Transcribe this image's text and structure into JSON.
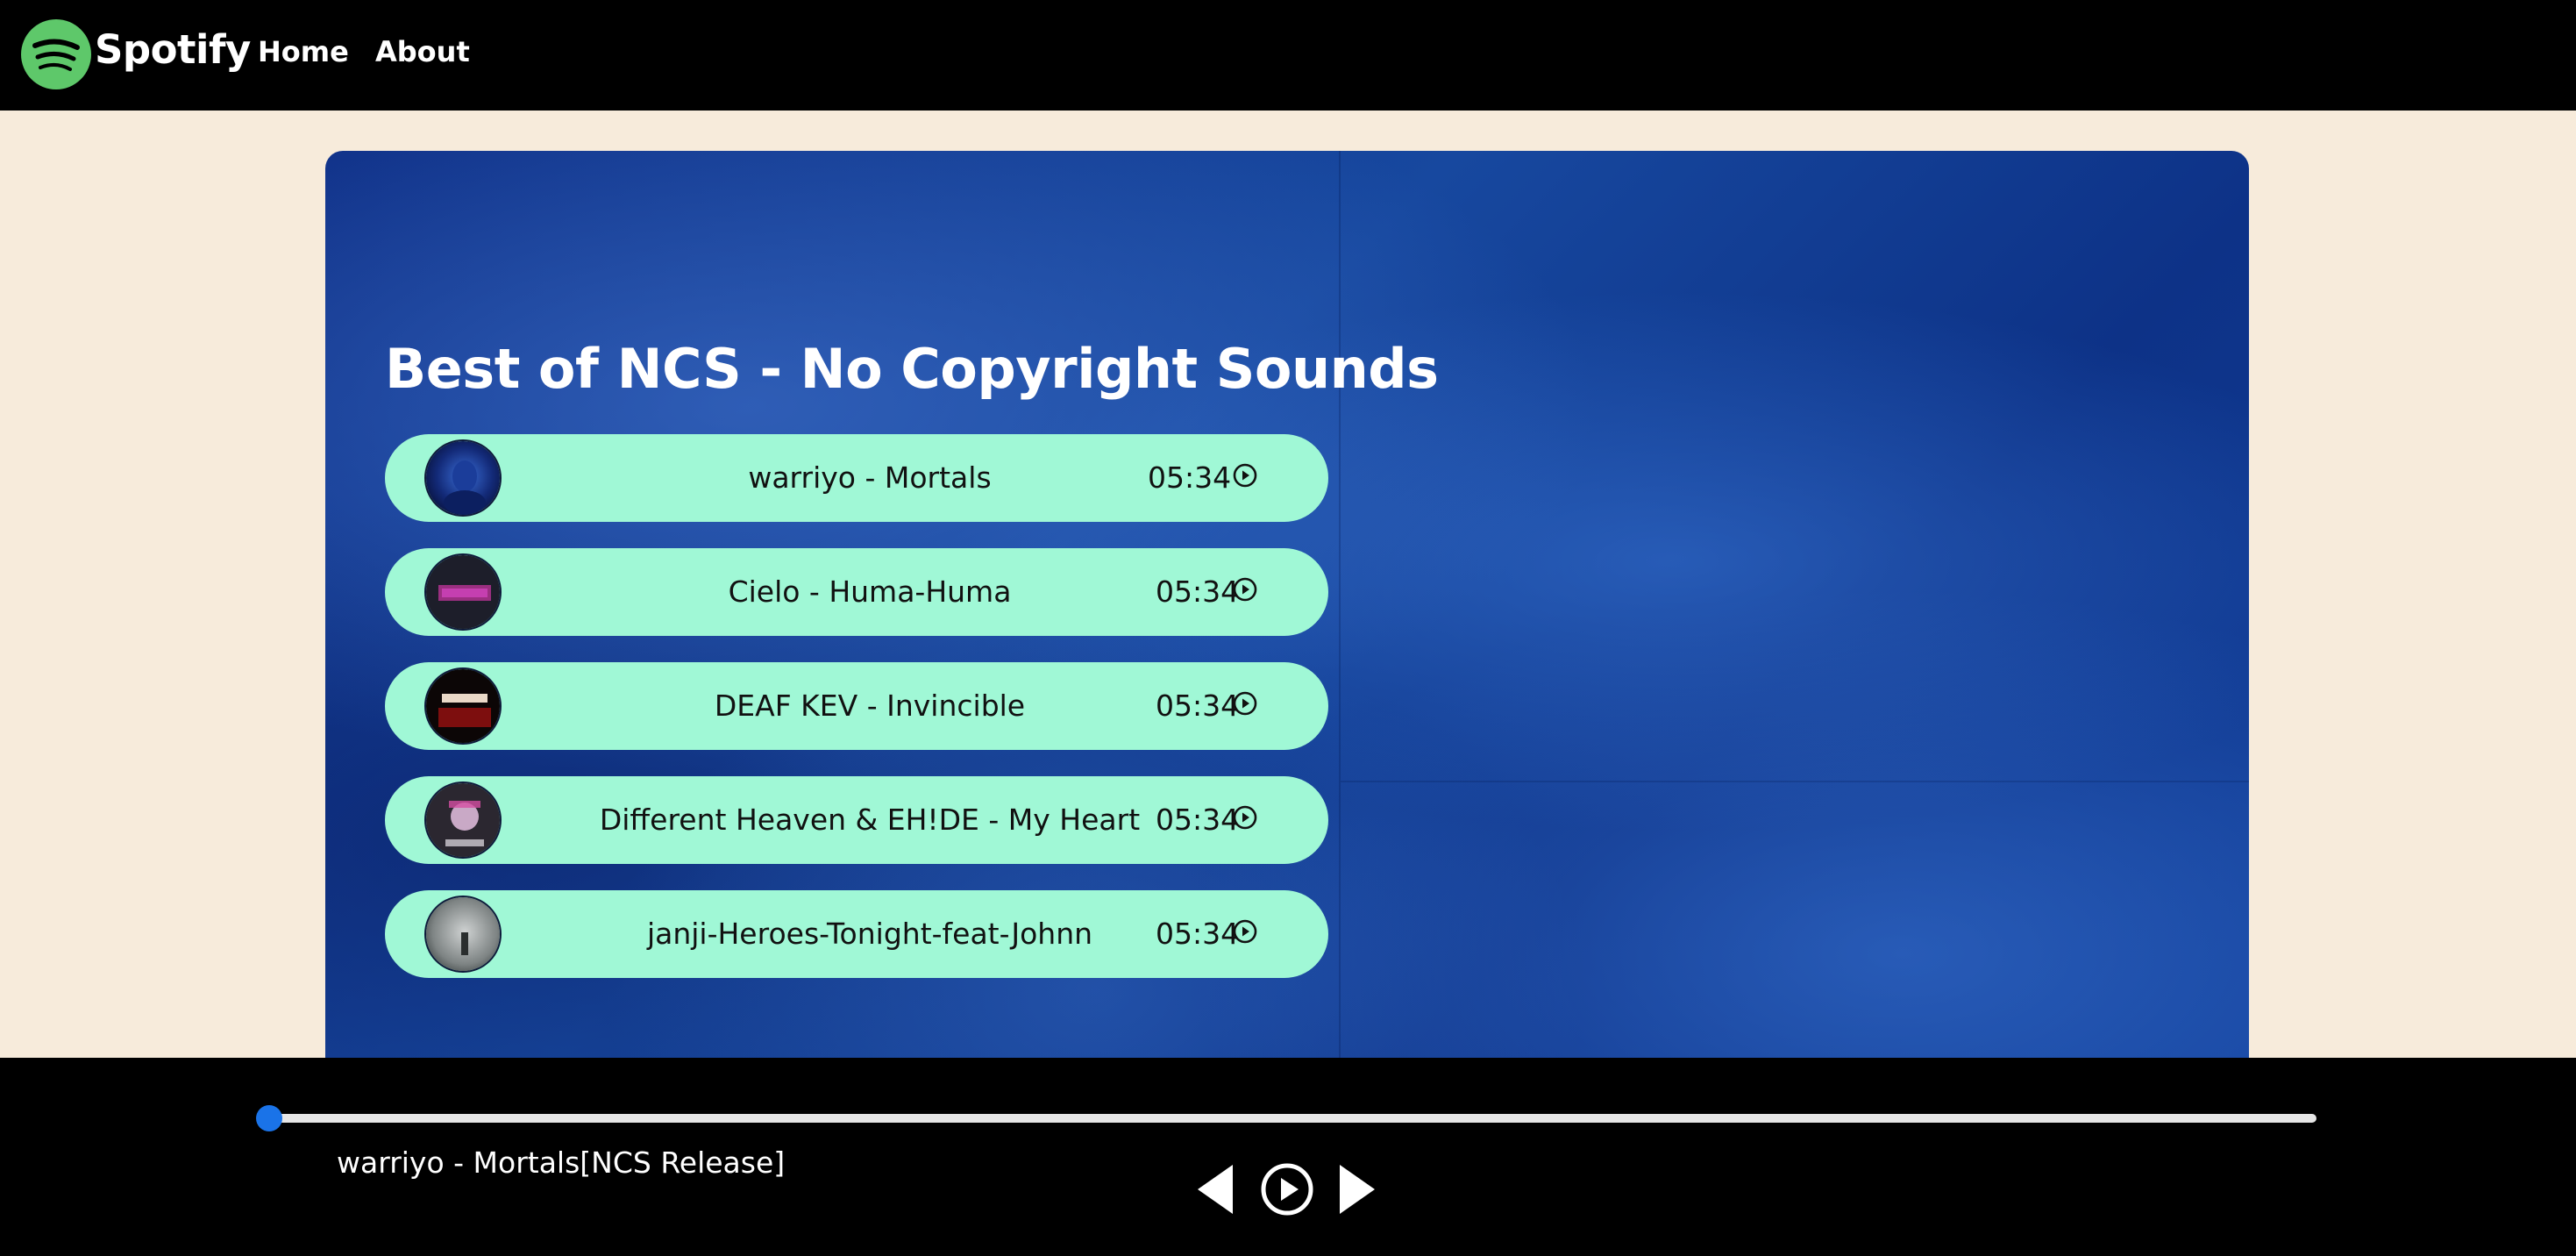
{
  "navbar": {
    "brand": "Spotify",
    "logo_icon": "spotify-logo-icon",
    "links": [
      {
        "label": "Home"
      },
      {
        "label": "About"
      }
    ]
  },
  "playlist": {
    "title": "Best of NCS - No Copyright Sounds",
    "songs": [
      {
        "name": "warriyo - Mortals",
        "duration": "05:34 ",
        "cover_icon": "album-cover-mortals",
        "play_icon": "play-circle-icon"
      },
      {
        "name": "Cielo - Huma-Huma",
        "duration": "05:34",
        "cover_icon": "album-cover-huma-huma",
        "play_icon": "play-circle-icon"
      },
      {
        "name": "DEAF KEV - Invincible",
        "duration": "05:34",
        "cover_icon": "album-cover-invincible",
        "play_icon": "play-circle-icon"
      },
      {
        "name": "Different Heaven & EH!DE - My Heart",
        "duration": "05:34",
        "cover_icon": "album-cover-my-heart",
        "play_icon": "play-circle-icon"
      },
      {
        "name": "janji-Heroes-Tonight-feat-Johnn",
        "duration": "05:34",
        "cover_icon": "album-cover-heroes-tonight",
        "play_icon": "play-circle-icon"
      }
    ]
  },
  "player": {
    "now_playing": "warriyo - Mortals[NCS Release]",
    "progress": 0,
    "controls": {
      "prev_icon": "previous-triangle-icon",
      "play_icon": "play-circle-icon",
      "next_icon": "next-triangle-icon"
    }
  },
  "colors": {
    "navbar_bg": "#000000",
    "page_bg": "#f7ebdb",
    "song_bg": "#a0f8d6",
    "logo_green": "#1ed760",
    "progress_accent": "#1a73e8"
  }
}
